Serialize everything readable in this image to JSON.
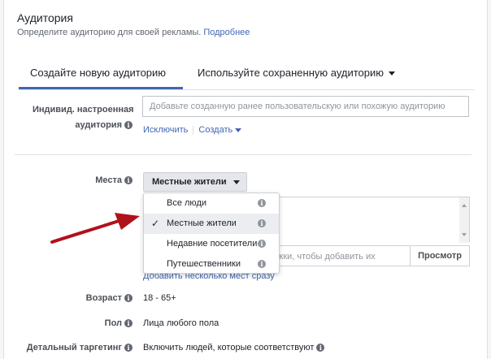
{
  "section": {
    "title": "Аудитория",
    "subtitle": "Определите аудиторию для своей рекламы.",
    "more_link": "Подробнее"
  },
  "tabs": [
    {
      "label": "Создайте новую аудиторию",
      "active": true
    },
    {
      "label": "Используйте сохраненную аудиторию",
      "active": false
    }
  ],
  "custom_audience": {
    "label_line1": "Индивид. настроенная",
    "label_line2": "аудитория",
    "placeholder": "Добавьте созданную ранее пользовательскую или похожую аудиторию",
    "exclude_link": "Исключить",
    "create_link": "Создать"
  },
  "places": {
    "label": "Места",
    "selected": "Местные жители",
    "options": [
      {
        "label": "Все люди",
        "checked": false
      },
      {
        "label": "Местные жители",
        "checked": true
      },
      {
        "label": "Недавние посетители",
        "checked": false
      },
      {
        "label": "Путешественники",
        "checked": false
      }
    ],
    "search_placeholder": "жки, чтобы добавить их",
    "browse_button": "Просмотр",
    "bulk_link": "Добавить несколько мест сразу"
  },
  "age": {
    "label": "Возраст",
    "value": "18 - 65+"
  },
  "gender": {
    "label": "Пол",
    "value": "Лица любого пола"
  },
  "detailed_targeting": {
    "label": "Детальный таргетинг",
    "value": "Включить людей, которые соответствуют"
  },
  "colors": {
    "accent": "#4267b2",
    "arrow": "#b0121b"
  }
}
